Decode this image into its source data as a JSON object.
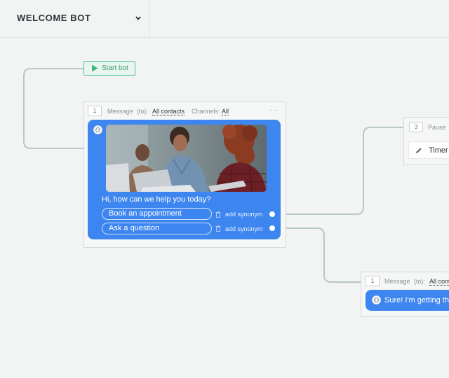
{
  "header": {
    "bot_name": "WELCOME BOT"
  },
  "start_node": {
    "label": "Start bot"
  },
  "message_node": {
    "number": "1",
    "type_label": "Message",
    "to_label": "(to):",
    "to_value": "All contacts",
    "channels_label": "Channels:",
    "channels_value": "All",
    "menu_label": "···",
    "text": "Hi, how can we help you today?",
    "buttons": [
      {
        "label": "Book an appointment",
        "synonym_label": "add synonym"
      },
      {
        "label": "Ask a question",
        "synonym_label": "add synonym"
      }
    ]
  },
  "pause_node": {
    "number": "3",
    "type_label": "Pause",
    "timer_label": "Timer"
  },
  "message_node_2": {
    "number": "1",
    "type_label": "Message",
    "to_label": "(to):",
    "to_value": "All cont",
    "text": "Sure! I'm getting the"
  },
  "colors": {
    "canvas": "#f2f3f3",
    "bubble": "#3d86f0",
    "start_border": "#50c48f",
    "connector": "#b9c7c7"
  },
  "icons": [
    "chevron-down-icon",
    "play-icon",
    "bot-avatar-icon",
    "trash-icon",
    "pencil-icon"
  ]
}
